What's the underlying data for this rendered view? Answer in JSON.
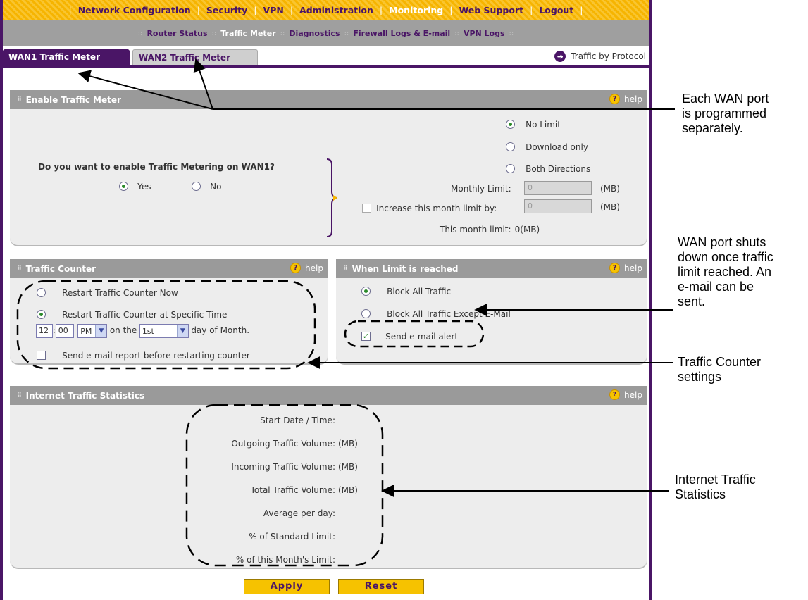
{
  "nav": {
    "items": [
      {
        "label": "Network Configuration",
        "active": false
      },
      {
        "label": "Security",
        "active": false
      },
      {
        "label": "VPN",
        "active": false
      },
      {
        "label": "Administration",
        "active": false
      },
      {
        "label": "Monitoring",
        "active": true
      },
      {
        "label": "Web Support",
        "active": false
      },
      {
        "label": "Logout",
        "active": false
      }
    ],
    "separator": "|"
  },
  "subnav": {
    "items": [
      {
        "label": "Router Status",
        "active": false
      },
      {
        "label": "Traffic Meter",
        "active": true
      },
      {
        "label": "Diagnostics",
        "active": false
      },
      {
        "label": "Firewall Logs & E-mail",
        "active": false
      },
      {
        "label": "VPN Logs",
        "active": false
      }
    ],
    "separator": "::"
  },
  "tabs": {
    "wan1": "WAN1 Traffic Meter",
    "wan2": "WAN2 Traffic Meter",
    "protocol_link": "Traffic by Protocol"
  },
  "enable": {
    "title": "Enable Traffic Meter",
    "help": "help",
    "question": "Do you want to enable Traffic Metering on WAN1?",
    "yes": "Yes",
    "no": "No",
    "enabled": "Yes",
    "no_limit": "No Limit",
    "download_only": "Download only",
    "both_directions": "Both Directions",
    "limit_selected": "No Limit",
    "monthly_limit_label": "Monthly Limit:",
    "monthly_limit_value": "0",
    "unit": "(MB)",
    "increase_label": "Increase this month limit by:",
    "increase_value": "0",
    "this_month_label": "This month limit:",
    "this_month_value": "0(MB)"
  },
  "counter": {
    "title": "Traffic Counter",
    "help": "help",
    "restart_now": "Restart Traffic Counter Now",
    "restart_specific": "Restart Traffic Counter at Specific Time",
    "hour": "12",
    "minute": "00",
    "ampm": "PM",
    "on_the": "on the",
    "day": "1st",
    "day_of_month": "day of Month.",
    "send_report": "Send e-mail report before restarting counter"
  },
  "limit": {
    "title": "When Limit is reached",
    "help": "help",
    "block_all": "Block All Traffic",
    "block_except": "Block All Traffic Except E-Mail",
    "send_alert": "Send e-mail alert",
    "send_alert_checked": true
  },
  "stats": {
    "title": "Internet Traffic Statistics",
    "help": "help",
    "rows": [
      {
        "label": "Start Date / Time:",
        "value": ""
      },
      {
        "label": "Outgoing Traffic Volume:",
        "value": "(MB)"
      },
      {
        "label": "Incoming Traffic Volume:",
        "value": "(MB)"
      },
      {
        "label": "Total Traffic Volume:",
        "value": "(MB)"
      },
      {
        "label": "Average per day:",
        "value": ""
      },
      {
        "label": "% of Standard Limit:",
        "value": ""
      },
      {
        "label": "% of this Month's Limit:",
        "value": ""
      }
    ]
  },
  "buttons": {
    "apply": "Apply",
    "reset": "Reset"
  },
  "callouts": {
    "wan_port": [
      "Each WAN port",
      "is programmed",
      "separately."
    ],
    "shutdown": [
      "WAN port shuts",
      "down once traffic",
      "limit reached. An",
      "e-mail can be",
      "sent."
    ],
    "counter": [
      "Traffic Counter",
      "settings"
    ],
    "statistics": [
      "Internet Traffic",
      "Statistics"
    ]
  },
  "colors": {
    "brand_purple": "#4a1566",
    "nav_yellow": "#f6b400",
    "panel_header": "#9a9a9a",
    "panel_body": "#ededed"
  }
}
